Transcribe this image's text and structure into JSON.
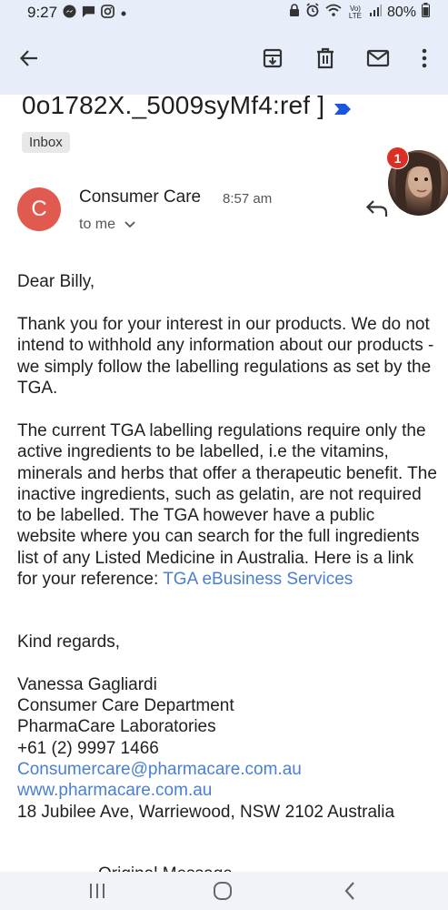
{
  "status_bar": {
    "time": "9:27",
    "battery": "80%",
    "network_label": "Vo) LTE"
  },
  "toolbar": {
    "back_icon": "arrow-left-icon",
    "archive_icon": "archive-icon",
    "delete_icon": "trash-icon",
    "mark_unread_icon": "mail-icon",
    "more_icon": "more-vert-icon"
  },
  "email": {
    "subject": "0o1782X._5009syMf4:ref ]",
    "label": "Inbox",
    "sender_initial": "C",
    "sender_name": "Consumer Care",
    "time": "8:57 am",
    "recipient": "to me",
    "greeting": "Dear Billy,",
    "paragraph1": "Thank you for your interest in our products. We do not intend to withhold any information about our products - we simply follow the labelling regulations as set by the TGA.",
    "paragraph2": "The current TGA labelling regulations require only the active ingredients to be labelled, i.e the vitamins, minerals and herbs that offer a therapeutic benefit. The inactive ingredients, such as gelatin, are not required to be labelled. The TGA however have a public website where you can search for the full ingredients list of any Listed Medicine in Australia. Here is a link for your reference: ",
    "paragraph2_link": "TGA eBusiness Services",
    "closing": "Kind regards,",
    "signature": {
      "name": "Vanessa Gagliardi",
      "department": "Consumer Care Department",
      "company": "PharmaCare Laboratories",
      "phone": "+61 (2) 9997 1466",
      "email": "Consumercare@pharmacare.com.au",
      "website": "www.pharmacare.com.au",
      "address": "18 Jubilee Ave, Warriewood, NSW 2102 Australia"
    },
    "original_message": "Original Message"
  },
  "chat_head": {
    "badge_count": "1"
  },
  "nav_bar": {
    "recents_icon": "recents-icon",
    "home_icon": "home-icon",
    "back_icon": "back-chevron-icon"
  },
  "colors": {
    "status_bg": "#e8eef9",
    "avatar_bg": "#e05a4f",
    "link": "#4a7fd1",
    "badge": "#d93025",
    "important_marker": "#1a56db"
  }
}
